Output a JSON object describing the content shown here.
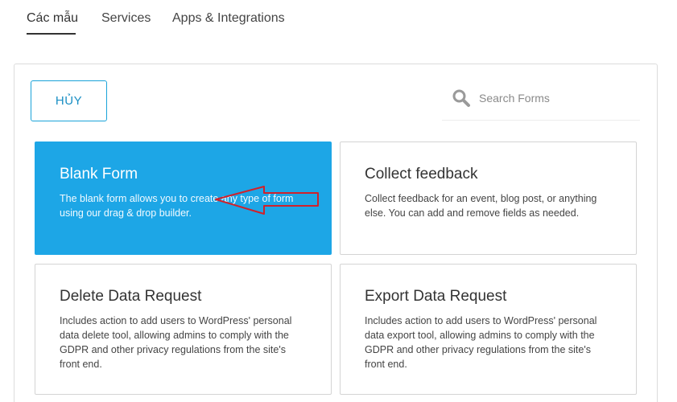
{
  "tabs": [
    {
      "label": "Các mẫu",
      "active": true
    },
    {
      "label": "Services",
      "active": false
    },
    {
      "label": "Apps & Integrations",
      "active": false
    }
  ],
  "toolbar": {
    "cancel_label": "HỦY",
    "search_placeholder": "Search Forms",
    "search_value": ""
  },
  "cards": [
    {
      "title": "Blank Form",
      "description": "The blank form allows you to create any type of form using our drag & drop builder.",
      "selected": true
    },
    {
      "title": "Collect feedback",
      "description": "Collect feedback for an event, blog post, or anything else. You can add and remove fields as needed.",
      "selected": false
    },
    {
      "title": "Delete Data Request",
      "description": "Includes action to add users to WordPress' personal data delete tool, allowing admins to comply with the GDPR and other privacy regulations from the site's front end.",
      "selected": false
    },
    {
      "title": "Export Data Request",
      "description": "Includes action to add users to WordPress' personal data export tool, allowing admins to comply with the GDPR and other privacy regulations from the site's front end.",
      "selected": false
    }
  ],
  "colors": {
    "accent": "#1da6e6",
    "button_border": "#1aa3d9",
    "annotation_arrow": "#d0212b"
  },
  "icons": {
    "search": "search-icon",
    "annotation": "arrow-left-annotation-icon"
  }
}
